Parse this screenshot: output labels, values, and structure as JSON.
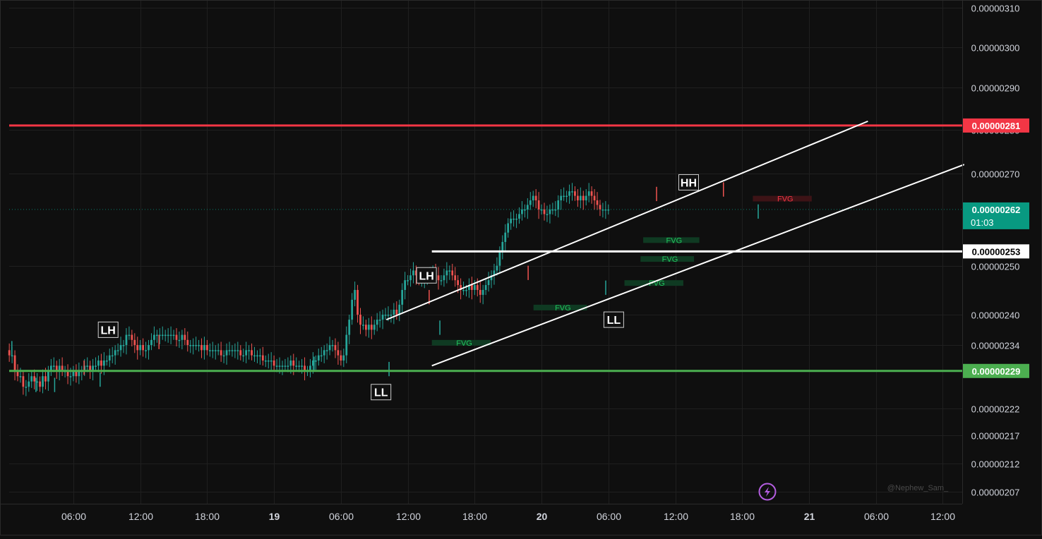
{
  "watermark": "@Nephew_Sam_",
  "icons": {
    "lightning": "lightning-bolt-icon"
  },
  "colors": {
    "background": "#0f0f0f",
    "grid": "#1f1f1f",
    "up": "#26a69a",
    "down": "#ef5350",
    "resistance": "#f23645",
    "support": "#4caf50",
    "level": "#ffffff",
    "current": "#089981",
    "fvg_bull_fill": "#0f3a22",
    "fvg_bull_text": "#22c55e",
    "fvg_bear_fill": "#3d1316",
    "fvg_bear_text": "#f23645",
    "accent": "#b45de0"
  },
  "chart_data": {
    "type": "candlestick",
    "title": "",
    "xlabel": "",
    "ylabel": "",
    "ylim": [
      2.05e-06,
      3.12e-06
    ],
    "y_scale": "log",
    "grid": true,
    "x_ticks": [
      {
        "label": "06:00",
        "day": 17.25,
        "bold": false
      },
      {
        "label": "12:00",
        "day": 17.5,
        "bold": false
      },
      {
        "label": "18:00",
        "day": 17.75,
        "bold": false
      },
      {
        "label": "19",
        "day": 18.0,
        "bold": true
      },
      {
        "label": "06:00",
        "day": 18.25,
        "bold": false
      },
      {
        "label": "12:00",
        "day": 18.5,
        "bold": false
      },
      {
        "label": "18:00",
        "day": 18.75,
        "bold": false
      },
      {
        "label": "20",
        "day": 19.0,
        "bold": true
      },
      {
        "label": "06:00",
        "day": 19.25,
        "bold": false
      },
      {
        "label": "12:00",
        "day": 19.5,
        "bold": false
      },
      {
        "label": "18:00",
        "day": 19.75,
        "bold": false
      },
      {
        "label": "21",
        "day": 20.0,
        "bold": true
      },
      {
        "label": "06:00",
        "day": 20.25,
        "bold": false
      },
      {
        "label": "12:00",
        "day": 20.5,
        "bold": false
      }
    ],
    "y_ticks": [
      {
        "label": "0.00000310",
        "value": 3.1e-06
      },
      {
        "label": "0.00000300",
        "value": 3e-06
      },
      {
        "label": "0.00000290",
        "value": 2.9e-06
      },
      {
        "label": "0.00000280",
        "value": 2.8e-06
      },
      {
        "label": "0.00000270",
        "value": 2.7e-06
      },
      {
        "label": "0.00000250",
        "value": 2.5e-06
      },
      {
        "label": "0.00000240",
        "value": 2.4e-06
      },
      {
        "label": "0.00000234",
        "value": 2.34e-06
      },
      {
        "label": "0.00000222",
        "value": 2.22e-06
      },
      {
        "label": "0.00000217",
        "value": 2.17e-06
      },
      {
        "label": "0.00000212",
        "value": 2.12e-06
      },
      {
        "label": "0.00000207",
        "value": 2.07e-06
      }
    ],
    "x_domain_days": [
      17.01,
      20.57
    ],
    "candle_start_day": 17.0,
    "candle_interval_days": 0.0104167,
    "candles_close": [
      2.33e-06,
      2.32e-06,
      2.32e-06,
      2.29e-06,
      2.28e-06,
      2.28e-06,
      2.26e-06,
      2.26e-06,
      2.27e-06,
      2.28e-06,
      2.27e-06,
      2.27e-06,
      2.26e-06,
      2.28e-06,
      2.27e-06,
      2.29e-06,
      2.3e-06,
      2.3e-06,
      2.29e-06,
      2.3e-06,
      2.29e-06,
      2.29e-06,
      2.28e-06,
      2.28e-06,
      2.29e-06,
      2.28e-06,
      2.29e-06,
      2.29e-06,
      2.3e-06,
      2.3e-06,
      2.29e-06,
      2.3e-06,
      2.3e-06,
      2.31e-06,
      2.3e-06,
      2.31e-06,
      2.31e-06,
      2.32e-06,
      2.32e-06,
      2.33e-06,
      2.33e-06,
      2.34e-06,
      2.34e-06,
      2.36e-06,
      2.36e-06,
      2.35e-06,
      2.34e-06,
      2.33e-06,
      2.34e-06,
      2.33e-06,
      2.33e-06,
      2.34e-06,
      2.35e-06,
      2.36e-06,
      2.36e-06,
      2.36e-06,
      2.36e-06,
      2.36e-06,
      2.36e-06,
      2.36e-06,
      2.36e-06,
      2.35e-06,
      2.35e-06,
      2.36e-06,
      2.35e-06,
      2.34e-06,
      2.34e-06,
      2.34e-06,
      2.34e-06,
      2.34e-06,
      2.33e-06,
      2.34e-06,
      2.33e-06,
      2.33e-06,
      2.33e-06,
      2.33e-06,
      2.33e-06,
      2.32e-06,
      2.32e-06,
      2.33e-06,
      2.33e-06,
      2.33e-06,
      2.33e-06,
      2.33e-06,
      2.32e-06,
      2.32e-06,
      2.33e-06,
      2.33e-06,
      2.32e-06,
      2.32e-06,
      2.32e-06,
      2.32e-06,
      2.31e-06,
      2.31e-06,
      2.31e-06,
      2.31e-06,
      2.3e-06,
      2.3e-06,
      2.3e-06,
      2.3e-06,
      2.3e-06,
      2.3e-06,
      2.31e-06,
      2.3e-06,
      2.3e-06,
      2.3e-06,
      2.3e-06,
      2.29e-06,
      2.29e-06,
      2.3e-06,
      2.31e-06,
      2.31e-06,
      2.32e-06,
      2.32e-06,
      2.33e-06,
      2.33e-06,
      2.34e-06,
      2.34e-06,
      2.33e-06,
      2.32e-06,
      2.31e-06,
      2.32e-06,
      2.36e-06,
      2.39e-06,
      2.43e-06,
      2.45e-06,
      2.4e-06,
      2.38e-06,
      2.38e-06,
      2.37e-06,
      2.38e-06,
      2.37e-06,
      2.38e-06,
      2.39e-06,
      2.39e-06,
      2.4e-06,
      2.4e-06,
      2.4e-06,
      2.4e-06,
      2.41e-06,
      2.4e-06,
      2.42e-06,
      2.45e-06,
      2.47e-06,
      2.47e-06,
      2.48e-06,
      2.49e-06,
      2.48e-06,
      2.47e-06,
      2.47e-06,
      2.48e-06,
      2.48e-06,
      2.48e-06,
      2.49e-06,
      2.48e-06,
      2.47e-06,
      2.47e-06,
      2.48e-06,
      2.49e-06,
      2.49e-06,
      2.48e-06,
      2.47e-06,
      2.46e-06,
      2.45e-06,
      2.45e-06,
      2.45e-06,
      2.46e-06,
      2.45e-06,
      2.46e-06,
      2.45e-06,
      2.44e-06,
      2.45e-06,
      2.46e-06,
      2.47e-06,
      2.48e-06,
      2.49e-06,
      2.5e-06,
      2.53e-06,
      2.55e-06,
      2.57e-06,
      2.59e-06,
      2.6e-06,
      2.6e-06,
      2.6e-06,
      2.61e-06,
      2.62e-06,
      2.62e-06,
      2.63e-06,
      2.64e-06,
      2.65e-06,
      2.64e-06,
      2.62e-06,
      2.62e-06,
      2.61e-06,
      2.61e-06,
      2.62e-06,
      2.62e-06,
      2.62e-06,
      2.64e-06,
      2.65e-06,
      2.65e-06,
      2.65e-06,
      2.66e-06,
      2.66e-06,
      2.65e-06,
      2.64e-06,
      2.65e-06,
      2.64e-06,
      2.65e-06,
      2.66e-06,
      2.65e-06,
      2.64e-06,
      2.63e-06,
      2.62e-06,
      2.62e-06,
      2.62e-06,
      2.62e-06
    ],
    "candle_markers": [
      {
        "day": 17.02,
        "low": 2.32e-06
      },
      {
        "day": 17.11,
        "low": 2.25e-06
      },
      {
        "day": 17.18,
        "low": 2.25e-06
      },
      {
        "day": 17.29,
        "high": 2.31e-06
      },
      {
        "day": 17.35,
        "low": 2.26e-06
      },
      {
        "day": 17.57,
        "high": 2.36e-06
      },
      {
        "day": 18.15,
        "low": 2.29e-06
      },
      {
        "day": 18.43,
        "low": 2.28e-06
      },
      {
        "day": 18.58,
        "high": 2.45e-06
      },
      {
        "day": 18.62,
        "low": 2.36e-06
      },
      {
        "day": 18.95,
        "high": 2.5e-06
      },
      {
        "day": 19.24,
        "low": 2.44e-06
      },
      {
        "day": 19.43,
        "high": 2.67e-06
      },
      {
        "day": 19.68,
        "high": 2.68e-06
      },
      {
        "day": 19.81,
        "low": 2.6e-06
      }
    ],
    "horizontal_levels": [
      {
        "value": 2.81e-06,
        "label": "0.00000281",
        "color": "#f23645",
        "text_color": "#ffffff",
        "thickness": 3
      },
      {
        "value": 2.29e-06,
        "label": "0.00000229",
        "color": "#4caf50",
        "text_color": "#ffffff",
        "thickness": 3
      },
      {
        "value": 2.53e-06,
        "label": "0.00000253",
        "color": "#ffffff",
        "text_color": "#000000",
        "thickness": 3,
        "start_day": 18.59
      }
    ],
    "current_price": {
      "value": 2.62e-06,
      "label": "0.00000262",
      "countdown": "01:03",
      "color": "#089981"
    },
    "channel_lines": [
      {
        "from": {
          "day": 18.42,
          "value": 2.39e-06
        },
        "to": {
          "day": 20.22,
          "value": 2.82e-06
        }
      },
      {
        "from": {
          "day": 18.59,
          "value": 2.3e-06
        },
        "to": {
          "day": 20.58,
          "value": 2.72e-06
        }
      }
    ],
    "structure_labels": [
      {
        "text": "LH",
        "day": 17.38,
        "value": 2.37e-06
      },
      {
        "text": "LL",
        "day": 18.4,
        "value": 2.25e-06
      },
      {
        "text": "LH",
        "day": 18.57,
        "value": 2.48e-06
      },
      {
        "text": "LL",
        "day": 19.27,
        "value": 2.39e-06
      },
      {
        "text": "HH",
        "day": 19.55,
        "value": 2.68e-06
      }
    ],
    "fvg_zones": [
      {
        "label": "FVG",
        "kind": "bull",
        "start_day": 18.59,
        "end_day": 18.81,
        "top": 2.35e-06,
        "bottom": 2.34e-06
      },
      {
        "label": "FVG",
        "kind": "bull",
        "start_day": 18.97,
        "end_day": 19.17,
        "top": 2.42e-06,
        "bottom": 2.41e-06
      },
      {
        "label": "FVG",
        "kind": "bull",
        "start_day": 19.31,
        "end_day": 19.53,
        "top": 2.47e-06,
        "bottom": 2.46e-06
      },
      {
        "label": "FVG",
        "kind": "bull",
        "start_day": 19.37,
        "end_day": 19.57,
        "top": 2.52e-06,
        "bottom": 2.51e-06
      },
      {
        "label": "FVG",
        "kind": "bull",
        "start_day": 19.38,
        "end_day": 19.59,
        "top": 2.56e-06,
        "bottom": 2.55e-06
      },
      {
        "label": "FVG",
        "kind": "bear",
        "start_day": 19.79,
        "end_day": 20.01,
        "top": 2.65e-06,
        "bottom": 2.64e-06
      }
    ]
  }
}
